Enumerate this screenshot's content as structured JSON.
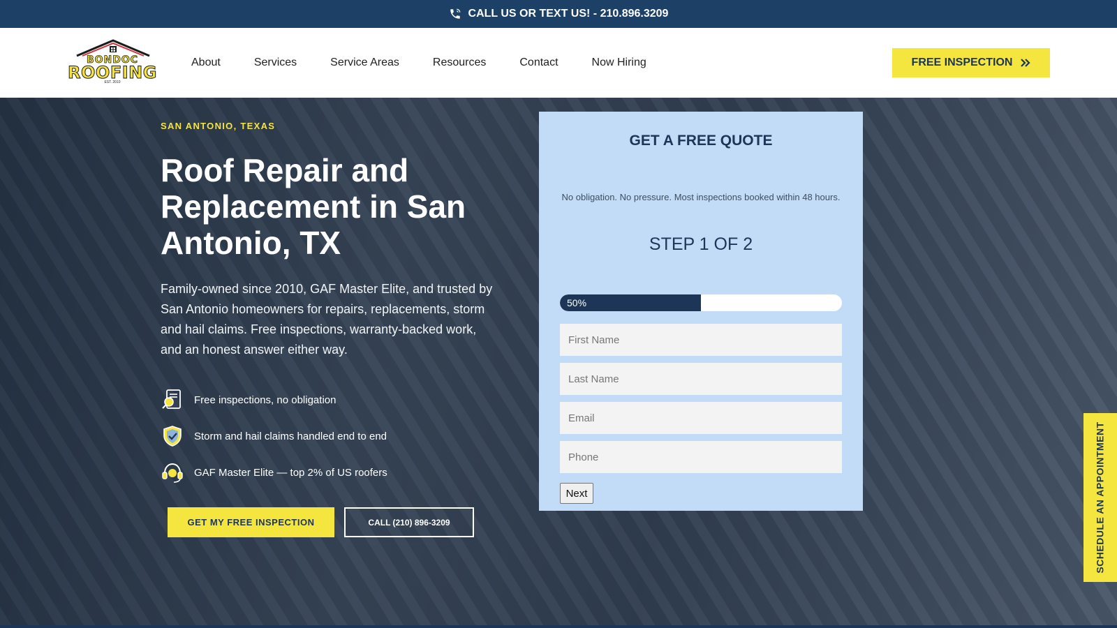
{
  "topbar": {
    "text": "CALL US OR TEXT US! - 210.896.3209",
    "icon": "phone-icon"
  },
  "logo": {
    "line1": "BONDOC",
    "line2": "ROOFING",
    "line3": "EST. 2010"
  },
  "nav": [
    {
      "label": "About"
    },
    {
      "label": "Services"
    },
    {
      "label": "Service Areas"
    },
    {
      "label": "Resources"
    },
    {
      "label": "Contact"
    },
    {
      "label": "Now Hiring"
    }
  ],
  "header_cta": {
    "label": "FREE INSPECTION",
    "icon": "double-chevron-right-icon"
  },
  "hero": {
    "eyebrow": "SAN ANTONIO, TEXAS",
    "title": "Roof Repair and Replacement in San Antonio, TX",
    "description": "Family-owned since 2010, GAF Master Elite, and trusted by San Antonio homeowners for repairs, replacements, storm and hail claims. Free inspections, warranty-backed work, and an honest answer either way.",
    "features": [
      {
        "icon": "inspection-report-icon",
        "text": "Free inspections, no obligation"
      },
      {
        "icon": "shield-check-icon",
        "text": "Storm and hail claims handled end to end"
      },
      {
        "icon": "headset-support-icon",
        "text": "GAF Master Elite — top 2% of US roofers"
      }
    ],
    "primary_button": "GET MY FREE INSPECTION",
    "secondary_button": "CALL (210) 896-3209"
  },
  "quote": {
    "title": "GET A FREE QUOTE",
    "subtitle": "No obligation. No pressure. Most inspections booked within 48 hours.",
    "step": "STEP 1 OF 2",
    "progress_percent": 50,
    "progress_label": "50%",
    "fields": {
      "first_name": "First Name",
      "last_name": "Last Name",
      "email": "Email",
      "phone": "Phone"
    },
    "next_label": "Next"
  },
  "side_tab": {
    "label": "SCHEDULE AN APPOINTMENT"
  },
  "colors": {
    "navy": "#1d3557",
    "yellow": "#f5e53f",
    "card": "#c2dcf7",
    "topbar": "#1d4166"
  }
}
